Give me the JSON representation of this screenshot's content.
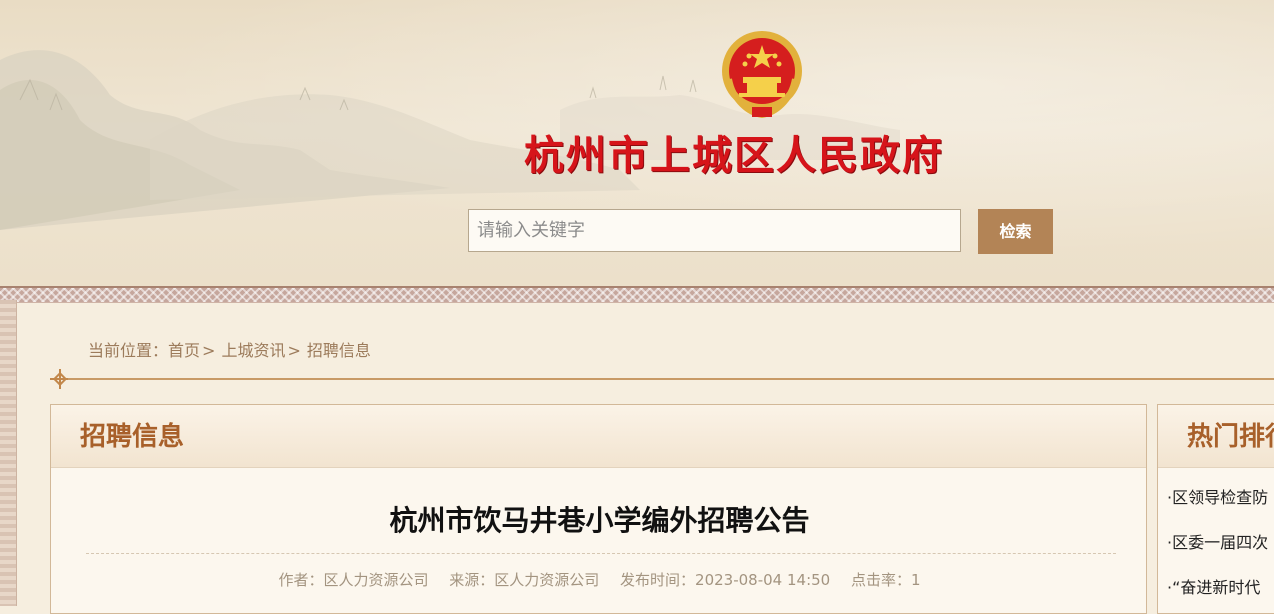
{
  "header": {
    "site_title": "杭州市上城区人民政府",
    "search_placeholder": "请输入关键字",
    "search_button": "检索"
  },
  "breadcrumb": {
    "prefix": "当前位置：",
    "items": [
      "首页",
      "上城资讯",
      "招聘信息"
    ],
    "separator": ">"
  },
  "main": {
    "section_title": "招聘信息",
    "article_title": "杭州市饮马井巷小学编外招聘公告",
    "meta": {
      "author": "作者：区人力资源公司",
      "source": "来源：区人力资源公司",
      "published": "发布时间：2023-08-04 14:50",
      "clicks": "点击率：1"
    }
  },
  "sidebar": {
    "title": "热门排行",
    "items": [
      "·区领导检查防",
      "·区委一届四次",
      "·“奋进新时代"
    ]
  },
  "colors": {
    "accent": "#b38456",
    "title_red": "#d6141a",
    "section_brown": "#a8602a",
    "background": "#f6eedf"
  }
}
